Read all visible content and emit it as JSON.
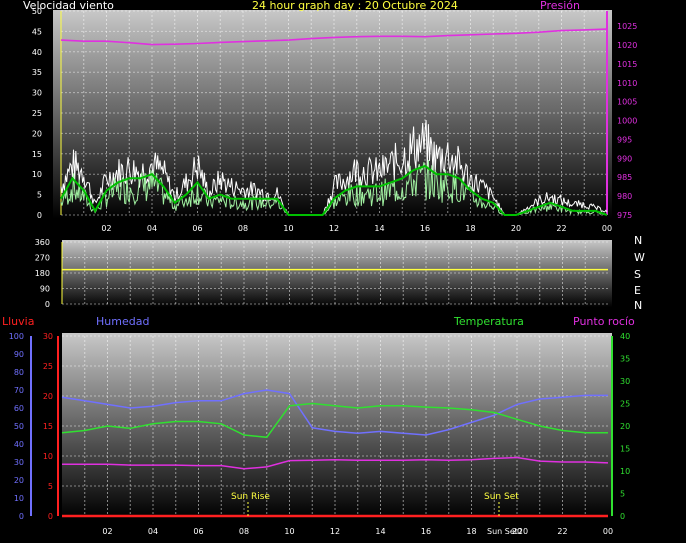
{
  "header": {
    "wind_label": "Velocidad viento",
    "title": "24 hour graph day : 20 Octubre 2024",
    "pressure_label": "Presión"
  },
  "lower_header": {
    "rain_label": "Lluvia",
    "humidity_label": "Humedad",
    "temperature_label": "Temperatura",
    "dewpoint_label": "Punto rocío"
  },
  "compass": [
    "N",
    "W",
    "S",
    "E",
    "N"
  ],
  "events": {
    "sunrise_label": "Sun Rise",
    "sunset_label": "Sun Set",
    "sunset_axis_label": "Sun Set20"
  },
  "colors": {
    "wind_gust": "#ffffff",
    "wind_avg": "#00c000",
    "wind_speed": "#a0f0a0",
    "pressure": "#e030e0",
    "direction": "#ffff40",
    "humidity": "#7070ff",
    "temperature": "#30e030",
    "dewpoint": "#e030e0",
    "rain": "#ff2020"
  },
  "chart_data": [
    {
      "type": "line",
      "name": "wind",
      "x_ticks": [
        "02",
        "04",
        "06",
        "08",
        "10",
        "12",
        "14",
        "16",
        "18",
        "20",
        "22",
        "00"
      ],
      "ylim_left": [
        0,
        50
      ],
      "yticks_left": [
        0,
        5,
        10,
        15,
        20,
        25,
        30,
        35,
        40,
        45,
        50
      ],
      "ylim_right": [
        975,
        1029
      ],
      "yticks_right": [
        975,
        980,
        985,
        990,
        995,
        1000,
        1005,
        1010,
        1015,
        1020,
        1025
      ],
      "series": [
        {
          "name": "Velocidad viento",
          "hours": [
            0,
            0.5,
            1,
            1.5,
            2,
            2.5,
            3,
            3.5,
            4,
            4.5,
            5,
            5.5,
            6,
            6.5,
            7,
            7.5,
            8,
            8.5,
            9,
            9.5,
            10,
            10.5,
            11,
            11.5,
            12,
            12.5,
            13,
            13.5,
            14,
            14.5,
            15,
            15.5,
            16,
            16.5,
            17,
            17.5,
            18,
            18.5,
            19,
            19.5,
            20,
            20.5,
            21,
            21.5,
            22,
            22.5,
            23,
            23.5,
            24
          ],
          "gust": [
            8,
            14,
            12,
            3,
            10,
            12,
            13,
            12,
            14,
            12,
            5,
            9,
            14,
            6,
            10,
            8,
            7,
            7,
            6,
            6,
            0,
            0,
            0,
            0,
            8,
            10,
            13,
            12,
            12,
            14,
            16,
            19,
            20,
            16,
            17,
            14,
            10,
            8,
            5,
            0,
            0,
            2,
            4,
            5,
            4,
            3,
            3,
            2,
            1
          ],
          "avg": [
            4,
            9,
            6,
            1,
            6,
            8,
            9,
            9,
            10,
            7,
            3,
            5,
            8,
            4,
            5,
            4,
            4,
            4,
            4,
            4,
            0,
            0,
            0,
            0,
            4,
            6,
            7,
            7,
            7,
            8,
            9,
            11,
            12,
            10,
            10,
            9,
            6,
            4,
            3,
            0,
            0,
            1,
            2,
            3,
            2,
            1,
            1,
            1,
            0
          ]
        },
        {
          "name": "Presión",
          "hours": [
            0,
            1,
            2,
            3,
            4,
            5,
            6,
            7,
            8,
            9,
            10,
            11,
            12,
            13,
            14,
            15,
            16,
            17,
            18,
            19,
            20,
            21,
            22,
            23,
            24
          ],
          "values": [
            1021.3,
            1021.0,
            1021.0,
            1020.6,
            1020.1,
            1020.2,
            1020.4,
            1020.7,
            1020.9,
            1021.1,
            1021.3,
            1021.7,
            1022.0,
            1022.2,
            1022.3,
            1022.3,
            1022.2,
            1022.5,
            1022.7,
            1022.9,
            1023.1,
            1023.4,
            1023.8,
            1024.0,
            1024.2
          ]
        }
      ]
    },
    {
      "type": "line",
      "name": "wind-direction",
      "ylim": [
        0,
        360
      ],
      "yticks": [
        0,
        90,
        180,
        270,
        360
      ],
      "series": [
        {
          "name": "Dirección",
          "hours": [
            0,
            24
          ],
          "values": [
            200,
            200
          ]
        }
      ]
    },
    {
      "type": "line",
      "name": "temp-hum",
      "x_ticks": [
        "02",
        "04",
        "06",
        "08",
        "10",
        "12",
        "14",
        "16",
        "18",
        "20",
        "22",
        "00"
      ],
      "ylim_humidity": [
        0,
        100
      ],
      "yticks_humidity": [
        0,
        10,
        20,
        30,
        40,
        50,
        60,
        70,
        80,
        90,
        100
      ],
      "ylim_rain": [
        0,
        30
      ],
      "yticks_rain": [
        0,
        5,
        10,
        15,
        20,
        25,
        30
      ],
      "ylim_temp": [
        0,
        40
      ],
      "yticks_temp": [
        0,
        5,
        10,
        15,
        20,
        25,
        30,
        35,
        40
      ],
      "series": [
        {
          "name": "Humedad",
          "hours": [
            0,
            1,
            2,
            3,
            4,
            5,
            6,
            7,
            8,
            9,
            10,
            11,
            12,
            13,
            14,
            15,
            16,
            17,
            18,
            19,
            20,
            21,
            22,
            23,
            24
          ],
          "values": [
            66,
            64,
            62,
            60,
            61,
            63,
            64,
            64,
            68,
            70,
            68,
            49,
            47,
            46,
            47,
            46,
            45,
            48,
            52,
            56,
            62,
            65,
            66,
            67,
            67
          ]
        },
        {
          "name": "Temperatura",
          "hours": [
            0,
            1,
            2,
            3,
            4,
            5,
            6,
            7,
            8,
            9,
            10,
            11,
            12,
            13,
            14,
            15,
            16,
            17,
            18,
            19,
            20,
            21,
            22,
            23,
            24
          ],
          "values": [
            18.5,
            19,
            20,
            19.5,
            20.5,
            21,
            21,
            20.5,
            18,
            17.5,
            24.5,
            25,
            24.5,
            24,
            24.5,
            24.5,
            24.2,
            24,
            23.6,
            23,
            21.5,
            20,
            19,
            18.5,
            18.5
          ]
        },
        {
          "name": "Punto rocío",
          "hours": [
            0,
            1,
            2,
            3,
            4,
            5,
            6,
            7,
            8,
            9,
            10,
            11,
            12,
            13,
            14,
            15,
            16,
            17,
            18,
            19,
            20,
            21,
            22,
            23,
            24
          ],
          "values": [
            11.5,
            11.5,
            11.5,
            11.3,
            11.3,
            11.3,
            11.2,
            11.2,
            10.5,
            10.9,
            12.3,
            12.4,
            12.5,
            12.4,
            12.4,
            12.4,
            12.5,
            12.4,
            12.5,
            12.8,
            13,
            12.2,
            12,
            12,
            11.8
          ]
        },
        {
          "name": "Lluvia",
          "hours": [
            0,
            24
          ],
          "values": [
            0,
            0
          ]
        }
      ]
    }
  ]
}
